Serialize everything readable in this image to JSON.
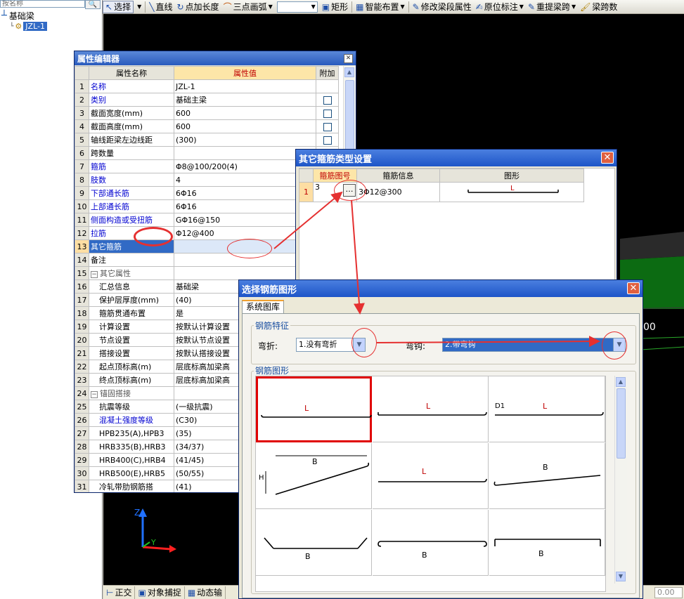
{
  "toolbar": {
    "select": "选择",
    "line": "直线",
    "point_length": "点加长度",
    "three_point_arc": "三点画弧",
    "rect": "矩形",
    "smart_layout": "智能布置",
    "modify_beam_segment": "修改梁段属性",
    "original_annotation": "原位标注",
    "reextract_span": "重提梁跨",
    "span_data": "梁跨数"
  },
  "tree": {
    "search_placeholder": "按名称",
    "root": "基础梁",
    "child": "JZL-1"
  },
  "prop_editor": {
    "title": "属性编辑器",
    "col_name": "属性名称",
    "col_value": "属性值",
    "col_extra": "附加",
    "rows": [
      {
        "n": "1",
        "name": "名称",
        "value": "JZL-1"
      },
      {
        "n": "2",
        "name": "类别",
        "value": "基础主梁"
      },
      {
        "n": "3",
        "name": "截面宽度(mm)",
        "value": "600"
      },
      {
        "n": "4",
        "name": "截面高度(mm)",
        "value": "600"
      },
      {
        "n": "5",
        "name": "轴线距梁左边线距",
        "value": "(300)"
      },
      {
        "n": "6",
        "name": "跨数量",
        "value": ""
      },
      {
        "n": "7",
        "name": "箍筋",
        "value": "Φ8@100/200(4)"
      },
      {
        "n": "8",
        "name": "肢数",
        "value": "4"
      },
      {
        "n": "9",
        "name": "下部通长筋",
        "value": "6Φ16"
      },
      {
        "n": "10",
        "name": "上部通长筋",
        "value": "6Φ16"
      },
      {
        "n": "11",
        "name": "侧面构造或受扭筋",
        "value": "GΦ16@150"
      },
      {
        "n": "12",
        "name": "拉筋",
        "value": "Φ12@400"
      },
      {
        "n": "13",
        "name": "其它箍筋",
        "value": ""
      },
      {
        "n": "14",
        "name": "备注",
        "value": ""
      },
      {
        "n": "15",
        "name": "其它属性",
        "value": ""
      },
      {
        "n": "16",
        "name": "汇总信息",
        "value": "基础梁"
      },
      {
        "n": "17",
        "name": "保护层厚度(mm)",
        "value": "(40)"
      },
      {
        "n": "18",
        "name": "箍筋贯通布置",
        "value": "是"
      },
      {
        "n": "19",
        "name": "计算设置",
        "value": "按默认计算设置"
      },
      {
        "n": "20",
        "name": "节点设置",
        "value": "按默认节点设置"
      },
      {
        "n": "21",
        "name": "搭接设置",
        "value": "按默认搭接设置"
      },
      {
        "n": "22",
        "name": "起点顶标高(m)",
        "value": "层底标高加梁高"
      },
      {
        "n": "23",
        "name": "终点顶标高(m)",
        "value": "层底标高加梁高"
      },
      {
        "n": "24",
        "name": "锚固搭接",
        "value": ""
      },
      {
        "n": "25",
        "name": "抗震等级",
        "value": "(一级抗震)"
      },
      {
        "n": "26",
        "name": "混凝土强度等级",
        "value": "(C30)"
      },
      {
        "n": "27",
        "name": "HPB235(A),HPB3",
        "value": "(35)"
      },
      {
        "n": "28",
        "name": "HRB335(B),HRB3",
        "value": "(34/37)"
      },
      {
        "n": "29",
        "name": "HRB400(C),HRB4",
        "value": "(41/45)"
      },
      {
        "n": "30",
        "name": "HRB500(E),HRB5",
        "value": "(50/55)"
      },
      {
        "n": "31",
        "name": "冷轧带肋钢筋搭",
        "value": "(41)"
      }
    ]
  },
  "stirrup_dialog": {
    "title": "其它箍筋类型设置",
    "col_shape_no": "箍筋图号",
    "col_info": "箍筋信息",
    "col_figure": "图形",
    "row_no": "1",
    "shape_no": "3",
    "ellipsis": "…",
    "info": "3Φ12@300",
    "fig_label": "L"
  },
  "shape_dialog": {
    "title": "选择钢筋图形",
    "tab": "系统图库",
    "features_label": "钢筋特征",
    "bend_label": "弯折:",
    "bend_value": "1.没有弯折",
    "hook_label": "弯钩:",
    "hook_value": "2.带弯钩",
    "shapes_label": "钢筋图形",
    "cells": [
      {
        "label": "L"
      },
      {
        "label": "L"
      },
      {
        "label": "L",
        "extra": "D1"
      },
      {
        "label": "B",
        "extra": "H"
      },
      {
        "label": "L"
      },
      {
        "label": "B"
      },
      {
        "label": "B"
      },
      {
        "label": "B"
      },
      {
        "label": "B"
      }
    ]
  },
  "status": {
    "ortho": "正交",
    "snap": "对象捕捉",
    "dynamic": "动态输",
    "zero": "0.00"
  },
  "canvas": {
    "axis_z": "Z",
    "axis_y": "Y",
    "dim_text": "00"
  }
}
